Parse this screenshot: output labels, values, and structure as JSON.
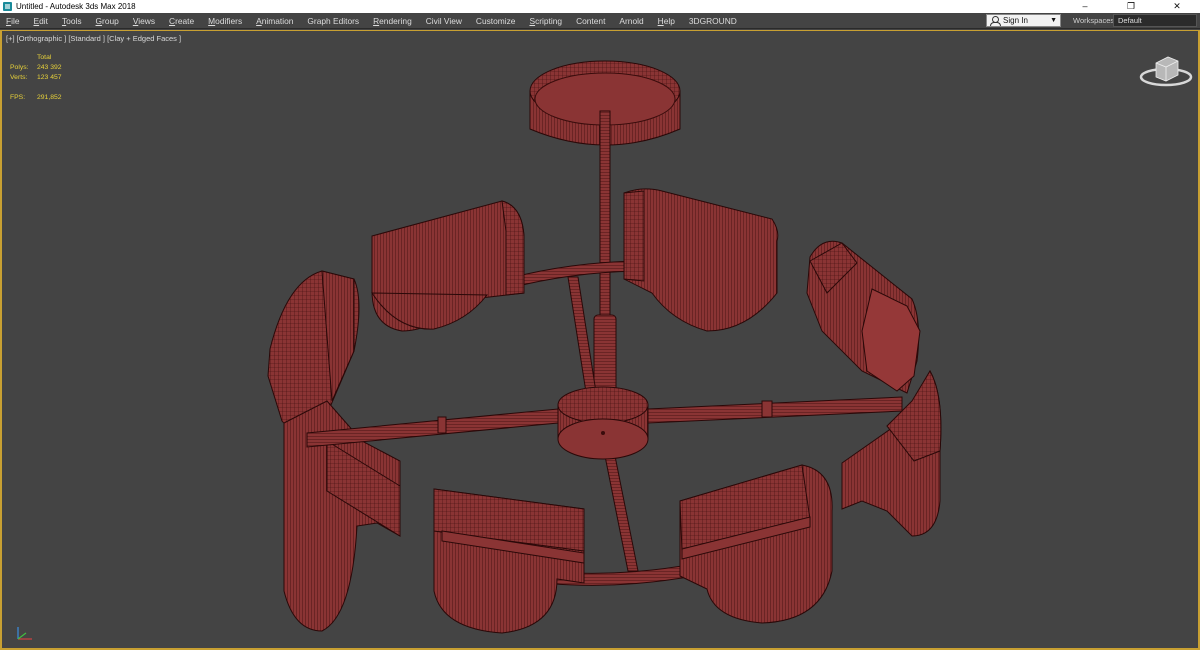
{
  "window": {
    "title": "Untitled - Autodesk 3ds Max 2018",
    "controls": [
      "–",
      "❐",
      "✕"
    ]
  },
  "menubar": {
    "items": [
      {
        "u": "F",
        "rest": "ile"
      },
      {
        "u": "E",
        "rest": "dit"
      },
      {
        "u": "T",
        "rest": "ools"
      },
      {
        "u": "G",
        "rest": "roup"
      },
      {
        "u": "V",
        "rest": "iews"
      },
      {
        "u": "C",
        "rest": "reate"
      },
      {
        "u": "M",
        "rest": "odifiers"
      },
      {
        "u": "A",
        "rest": "nimation"
      },
      {
        "u": "",
        "rest": "Graph Editors"
      },
      {
        "u": "R",
        "rest": "endering"
      },
      {
        "u": "",
        "rest": "Civil View"
      },
      {
        "u": "",
        "rest": "Customize"
      },
      {
        "u": "S",
        "rest": "cripting"
      },
      {
        "u": "",
        "rest": "Content"
      },
      {
        "u": "",
        "rest": "Arnold"
      },
      {
        "u": "H",
        "rest": "elp"
      },
      {
        "u": "",
        "rest": "3DGROUND"
      }
    ],
    "sign_in": "Sign In",
    "workspaces_label": "Workspaces:",
    "workspace_value": "Default"
  },
  "viewport": {
    "label": "[+] [Orthographic ] [Standard ] [Clay + Edged Faces ]",
    "stats": {
      "header": "Total",
      "polys_label": "Polys:",
      "polys_value": "243 392",
      "verts_label": "Verts:",
      "verts_value": "123 457",
      "fps_label": "FPS:",
      "fps_value": "291,852"
    }
  },
  "colors": {
    "viewport_bg": "#444444",
    "model_fill": "#8a3434",
    "model_edge": "#3a0c0c",
    "viewport_border": "#c8a032",
    "stats_text": "#e8d23a"
  },
  "icons": [
    "app-icon",
    "user-icon",
    "viewcube-icon",
    "axis-tripod-icon"
  ]
}
